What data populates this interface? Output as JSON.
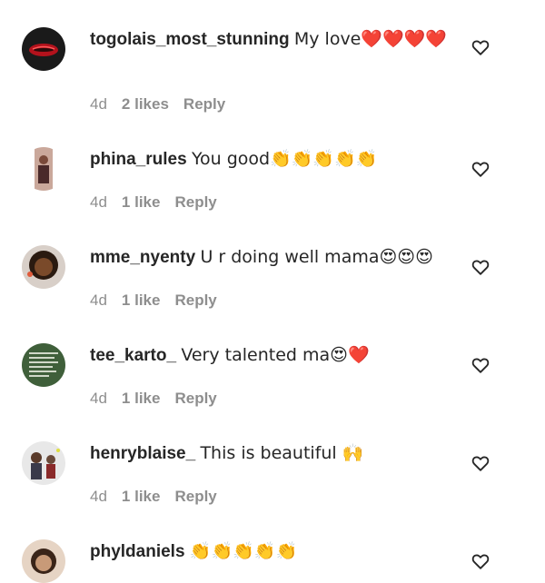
{
  "comments": [
    {
      "username": "togolais_most_stunning",
      "text": "My love❤️❤️❤️❤️",
      "time": "4d",
      "likes": "2 likes",
      "reply": "Reply",
      "avatar_color": "#1a1a1a"
    },
    {
      "username": "phina_rules",
      "text": "You good👏👏👏👏👏",
      "time": "4d",
      "likes": "1 like",
      "reply": "Reply",
      "avatar_color": "#c9a7a0"
    },
    {
      "username": "mme_nyenty",
      "text": "U r doing well mama😍😍😍",
      "time": "4d",
      "likes": "1 like",
      "reply": "Reply",
      "avatar_color": "#6b3d22"
    },
    {
      "username": "tee_karto_",
      "text": "Very talented ma😍❤️",
      "time": "4d",
      "likes": "1 like",
      "reply": "Reply",
      "avatar_color": "#4a6b45"
    },
    {
      "username": "henryblaise_",
      "text": "This is beautiful 🙌",
      "time": "4d",
      "likes": "1 like",
      "reply": "Reply",
      "avatar_color": "#8a8a8a"
    },
    {
      "username": "phyldaniels",
      "text": "👏👏👏👏👏",
      "time": "",
      "likes": "",
      "reply": "",
      "avatar_color": "#d9b89c"
    }
  ],
  "icons": {
    "like": "heart-outline-icon"
  }
}
